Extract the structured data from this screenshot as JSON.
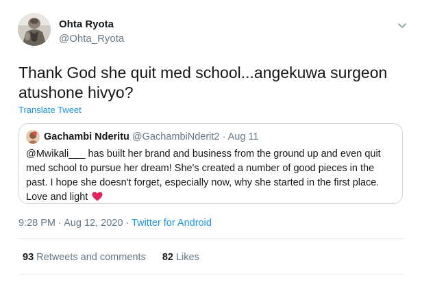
{
  "tweet": {
    "author_name": "Ohta Ryota",
    "author_handle": "@Ohta_Ryota",
    "text": "Thank God she quit med school...angekuwa surgeon atushone hivyo?",
    "translate_label": "Translate Tweet",
    "time": "9:28 PM",
    "date": "Aug 12, 2020",
    "source": "Twitter for Android",
    "retweets_count": "93",
    "retweets_label": "Retweets and comments",
    "likes_count": "82",
    "likes_label": "Likes"
  },
  "quoted": {
    "author_name": "Gachambi Nderitu",
    "author_handle": "@GachambiNderit2",
    "date": "Aug 11",
    "text": "@Mwikali___ has built her brand and business from the ground up and even quit med school to pursue her dream! She's created a number of good pieces in the past. I hope she doesn't forget, especially now, why she started in the first place. Love and light"
  },
  "colors": {
    "link": "#1b95e0",
    "secondary_text": "#657786",
    "heart": "#e0245e"
  },
  "icons": {
    "caret": "chevron-down-icon",
    "heart": "heart-icon"
  }
}
